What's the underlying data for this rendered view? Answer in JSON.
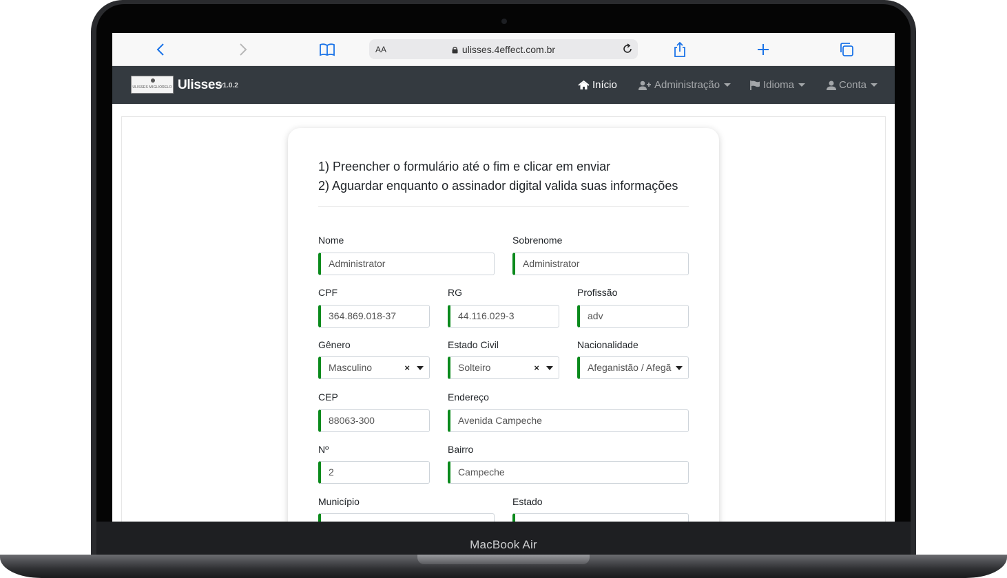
{
  "device": {
    "model": "MacBook Air"
  },
  "browser": {
    "aa_label": "AA",
    "url": "ulisses.4effect.com.br"
  },
  "navbar": {
    "brand": "Ulisses",
    "version": "v1.0.2",
    "logo_text": "ULISSES MIGLIORELO",
    "items": [
      {
        "label": "Início",
        "icon": "home-icon",
        "active": true
      },
      {
        "label": "Administração",
        "icon": "user-plus-icon",
        "active": false
      },
      {
        "label": "Idioma",
        "icon": "flag-icon",
        "active": false
      },
      {
        "label": "Conta",
        "icon": "user-icon",
        "active": false
      }
    ]
  },
  "instructions": {
    "line1": "1) Preencher o formulário até o fim e clicar em enviar",
    "line2": "2) Aguardar enquanto o assinador digital valida suas informações"
  },
  "form": {
    "nome": {
      "label": "Nome",
      "value": "Administrator"
    },
    "sobrenome": {
      "label": "Sobrenome",
      "value": "Administrator"
    },
    "cpf": {
      "label": "CPF",
      "value": "364.869.018-37"
    },
    "rg": {
      "label": "RG",
      "value": "44.116.029-3"
    },
    "profissao": {
      "label": "Profissão",
      "value": "adv"
    },
    "genero": {
      "label": "Gênero",
      "value": "Masculino"
    },
    "estado_civil": {
      "label": "Estado Civil",
      "value": "Solteiro"
    },
    "nacionalidade": {
      "label": "Nacionalidade",
      "value": "Afeganistão / Afegã"
    },
    "cep": {
      "label": "CEP",
      "value": "88063-300"
    },
    "endereco": {
      "label": "Endereço",
      "value": "Avenida Campeche"
    },
    "numero": {
      "label": "Nº",
      "value": "2"
    },
    "bairro": {
      "label": "Bairro",
      "value": "Campeche"
    },
    "municipio": {
      "label": "Município",
      "value": ""
    },
    "estado": {
      "label": "Estado",
      "value": ""
    },
    "clear_symbol": "×"
  },
  "colors": {
    "navbar_bg": "#343a40",
    "field_valid_border": "#0a8a1c",
    "safari_accent": "#1a73e8"
  }
}
